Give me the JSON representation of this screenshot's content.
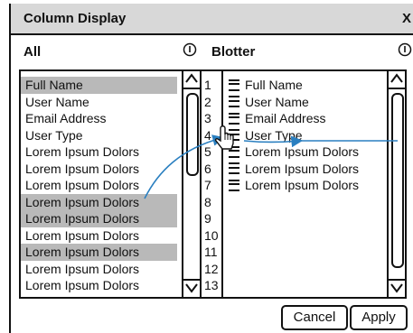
{
  "dialog": {
    "title": "Column Display",
    "close_label": "X"
  },
  "all_panel": {
    "header": "All",
    "info_icon": "info-circle-icon",
    "items": [
      {
        "label": "Full Name",
        "selected": true
      },
      {
        "label": "User Name",
        "selected": false
      },
      {
        "label": "Email Address",
        "selected": false
      },
      {
        "label": "User Type",
        "selected": false
      },
      {
        "label": "Lorem Ipsum Dolors",
        "selected": false
      },
      {
        "label": "Lorem Ipsum Dolors",
        "selected": false
      },
      {
        "label": "Lorem Ipsum Dolors",
        "selected": false
      },
      {
        "label": "Lorem Ipsum Dolors",
        "selected": true
      },
      {
        "label": "Lorem Ipsum Dolors",
        "selected": true
      },
      {
        "label": "Lorem Ipsum Dolors",
        "selected": false
      },
      {
        "label": "Lorem Ipsum Dolors",
        "selected": true
      },
      {
        "label": "Lorem Ipsum Dolors",
        "selected": false
      },
      {
        "label": "Lorem Ipsum Dolors",
        "selected": false
      }
    ]
  },
  "blotter_panel": {
    "header": "Blotter",
    "info_icon": "info-circle-icon",
    "row_numbers": [
      "1",
      "2",
      "3",
      "4",
      "5",
      "6",
      "7",
      "8",
      "9",
      "10",
      "11",
      "12",
      "13"
    ],
    "items": [
      "Full Name",
      "User Name",
      "Email Address",
      "User Type",
      "Lorem Ipsum Dolors",
      "Lorem Ipsum Dolors",
      "Lorem Ipsum Dolors"
    ]
  },
  "buttons": {
    "cancel": "Cancel",
    "apply": "Apply"
  },
  "colors": {
    "selection": "#b9b9b9",
    "drag_arrow": "#2a7fc0",
    "titlebar": "#d8d8d8"
  }
}
